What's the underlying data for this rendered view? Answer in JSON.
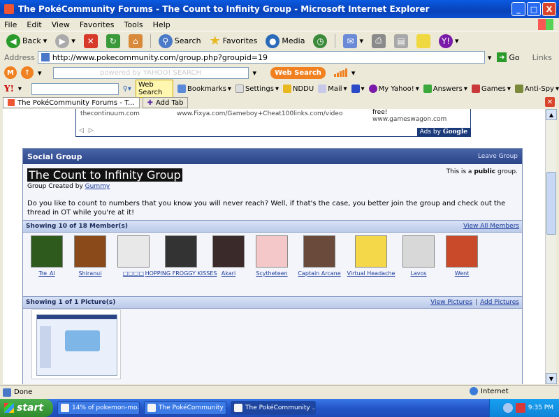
{
  "window": {
    "title": "The PokéCommunity Forums - The Count to Infinity Group - Microsoft Internet Explorer",
    "min": "_",
    "max": "□",
    "close": "X"
  },
  "menu": [
    "File",
    "Edit",
    "View",
    "Favorites",
    "Tools",
    "Help"
  ],
  "toolbar": {
    "back": "Back",
    "search": "Search",
    "favorites": "Favorites",
    "media": "Media"
  },
  "address": {
    "label": "Address",
    "url": "http://www.pokecommunity.com/group.php?groupid=19",
    "go": "Go",
    "links": "Links"
  },
  "yahoo1": {
    "search_placeholder": "powered by YAHOO! SEARCH",
    "web_search": "Web Search"
  },
  "yahoo2": {
    "logo": "Y!",
    "web_search": "Web Search",
    "bookmarks": "Bookmarks",
    "settings": "Settings",
    "nddu": "NDDU",
    "mail": "Mail",
    "myyahoo": "My Yahoo!",
    "answers": "Answers",
    "games": "Games",
    "antispy": "Anti-Spy"
  },
  "tabs": {
    "current": "The PokéCommunity Forums - T...",
    "add": "Add Tab"
  },
  "ad": {
    "line1": "thecontinuum.com",
    "line2": "www.Fixya.com/Gameboy+Cheat100links.com/video",
    "line3": "free!",
    "line4": "www.gameswagon.com",
    "arrows": "◁ ▷",
    "ads_by": "Ads by",
    "google": "Google"
  },
  "group": {
    "header": "Social Group",
    "leave": "Leave Group",
    "title": "The Count to Infinity Group",
    "created_by_label": "Group Created by",
    "creator": "Gummy",
    "public_pre": "This is a",
    "public_word": "public",
    "public_post": "group.",
    "description": "Do you like to count to numbers that you know you will never reach? Well, if that's the case, you better join the group and check out the thread in OT while you're at it!",
    "members_bar": "Showing 10 of 18 Member(s)",
    "view_all": "View All Members",
    "pictures_bar": "Showing 1 of 1 Picture(s)",
    "view_pictures": "View Pictures",
    "add_pictures": "Add Pictures",
    "separator": "|"
  },
  "members": [
    {
      "name": "Tre_Al",
      "color": "#2f5a1e"
    },
    {
      "name": "Shiranui",
      "color": "#8a4a1a"
    },
    {
      "name": "□□□□",
      "color": "#e8e8e8"
    },
    {
      "name": "HOPPING FROGGY KISSES",
      "color": "#333333"
    },
    {
      "name": "Akari",
      "color": "#3a2a2a"
    },
    {
      "name": "Scytheteen",
      "color": "#f4c8c8"
    },
    {
      "name": "Captain Arcane",
      "color": "#6a4a3a"
    },
    {
      "name": "Virtual Headache",
      "color": "#f4d84a"
    },
    {
      "name": "Lavos",
      "color": "#d8d8d8"
    },
    {
      "name": "Went",
      "color": "#c84a2a"
    }
  ],
  "status": {
    "done": "Done",
    "zone": "Internet"
  },
  "taskbar": {
    "start": "start",
    "task1": "14% of pokemon-mo...",
    "task2": "The PokéCommunity ...",
    "task3": "The PokéCommunity ...",
    "time": "9:35 PM"
  }
}
